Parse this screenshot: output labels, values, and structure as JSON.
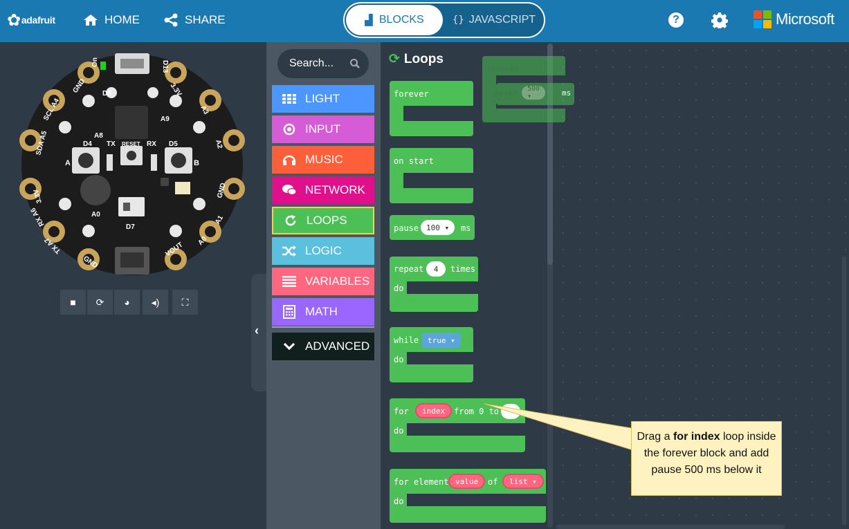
{
  "topbar": {
    "brand": "adafruit",
    "home": "HOME",
    "share": "SHARE",
    "mode_blocks": "BLOCKS",
    "mode_javascript": "JAVASCRIPT",
    "help": "?",
    "microsoft": "Microsoft",
    "colors": {
      "bar": "#1b79b1"
    }
  },
  "simulator": {
    "pin_labels": [
      "On",
      "D13",
      "GND",
      "3.3V",
      "SCL",
      "A4",
      "A3",
      "D8",
      "A9",
      "SDA",
      "A5",
      "A2",
      "A8",
      "D4",
      "TX",
      "RESET",
      "RX",
      "D5",
      "3.3V",
      "GND",
      "A1",
      "RX",
      "A6",
      "A0",
      "D7",
      "TX",
      "A7",
      "A0",
      "GND",
      "VOUT"
    ],
    "controls": [
      "stop-icon",
      "restart-icon",
      "slow-motion-icon",
      "mute-icon",
      "fullscreen-icon"
    ]
  },
  "toolbox": {
    "search_placeholder": "Search...",
    "categories": [
      {
        "label": "LIGHT",
        "color": "#4c97ff",
        "icon": "grid-icon"
      },
      {
        "label": "INPUT",
        "color": "#d65cd6",
        "icon": "circle-dot-icon"
      },
      {
        "label": "MUSIC",
        "color": "#fe5f3b",
        "icon": "headphones-icon"
      },
      {
        "label": "NETWORK",
        "color": "#e0108c",
        "icon": "chat-icon"
      },
      {
        "label": "LOOPS",
        "color": "#4cbf56",
        "icon": "refresh-icon"
      },
      {
        "label": "LOGIC",
        "color": "#5bc0de",
        "icon": "shuffle-icon"
      },
      {
        "label": "VARIABLES",
        "color": "#ff6680",
        "icon": "list-icon"
      },
      {
        "label": "MATH",
        "color": "#9966ff",
        "icon": "calculator-icon"
      }
    ],
    "advanced": "ADVANCED",
    "selected": "LOOPS"
  },
  "flyout": {
    "title": "Loops",
    "blocks": {
      "forever": "forever",
      "on_start": "on start",
      "pause": "pause",
      "pause_value": "100 ▾",
      "pause_unit": "ms",
      "repeat": "repeat",
      "repeat_value": "4",
      "repeat_times": "times",
      "do": "do",
      "while": "while",
      "while_value": "true ▾",
      "for": "for",
      "for_var": "index",
      "from_to": "from 0 to",
      "for_element": "for element",
      "element_var": "value",
      "of": "of",
      "list_var": "list ▾"
    }
  },
  "workspace": {
    "forever": "forever",
    "pause": "pause",
    "pause_value": "500 ▾",
    "pause_unit": "ms"
  },
  "callout": {
    "before": "Drag a ",
    "bold": "for index",
    "after": " loop inside the forever block and add pause 500 ms below it"
  }
}
